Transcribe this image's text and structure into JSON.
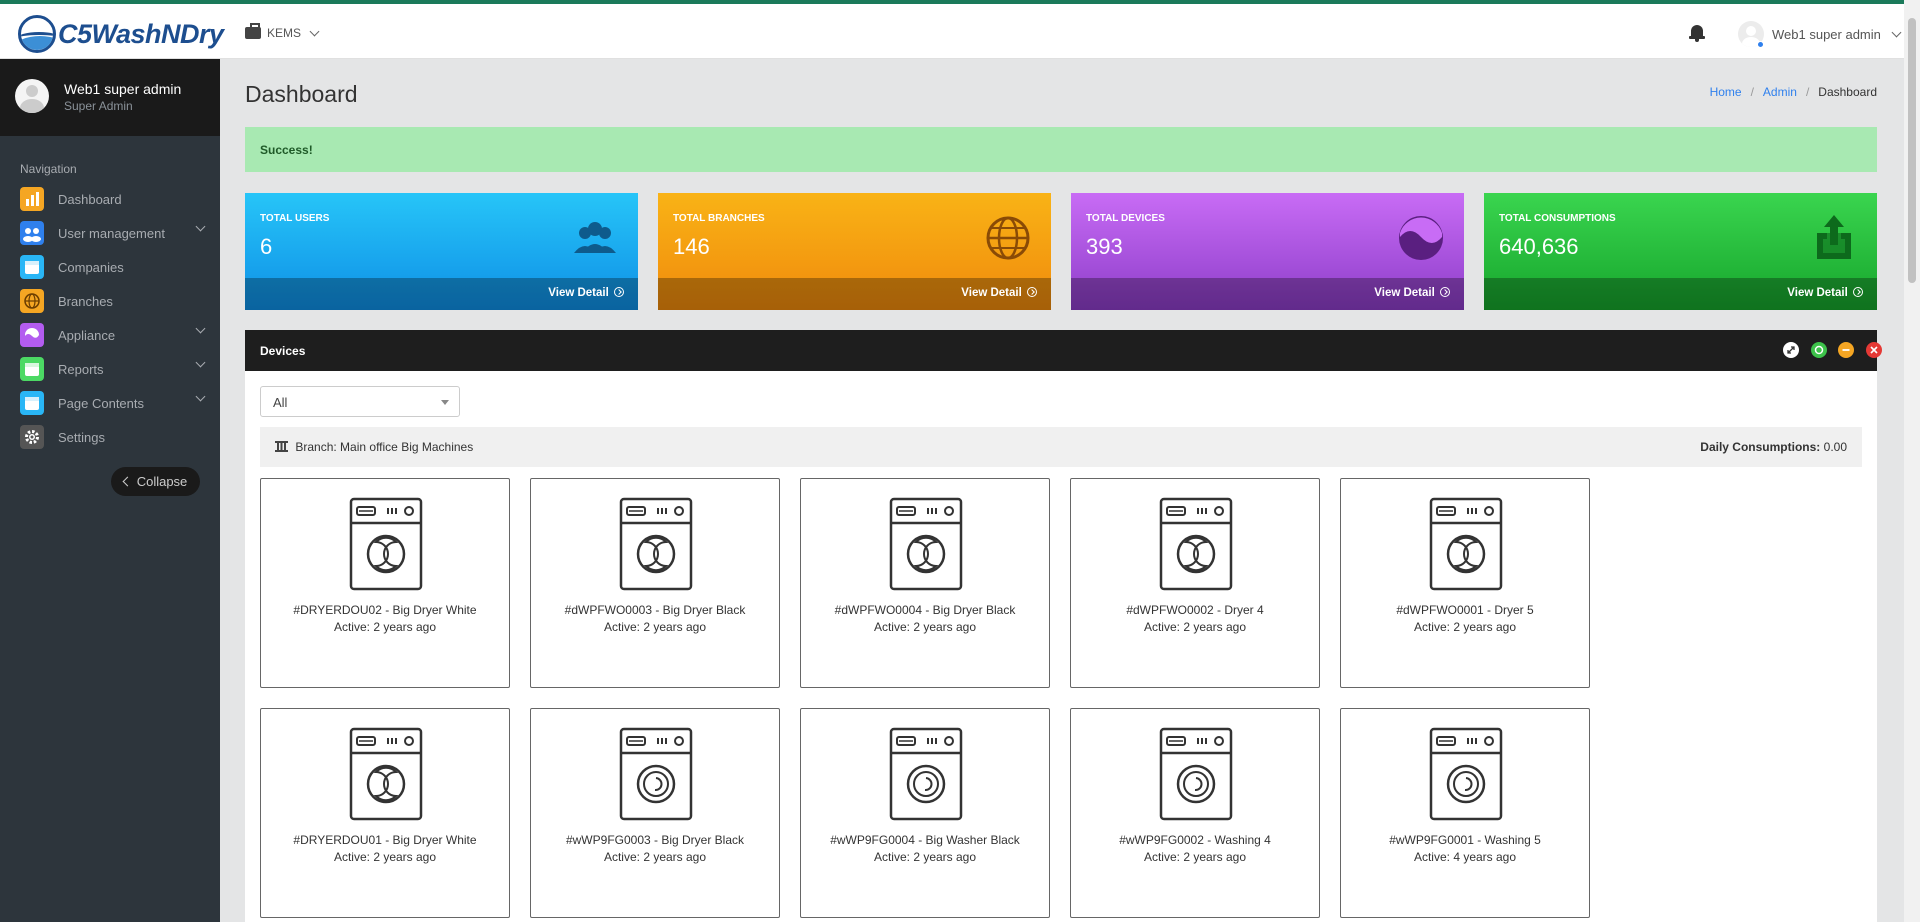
{
  "header": {
    "logo_text": "C5WashNDry",
    "company": "KEMS",
    "user_name": "Web1 super admin"
  },
  "sidebar": {
    "profile_name": "Web1 super admin",
    "profile_role": "Super Admin",
    "nav_title": "Navigation",
    "items": [
      {
        "label": "Dashboard",
        "icon": "bar-chart-icon",
        "color": "#f5a623"
      },
      {
        "label": "User management",
        "icon": "users-icon",
        "color": "#2f80ed"
      },
      {
        "label": "Companies",
        "icon": "calendar-icon",
        "color": "#29b6f6"
      },
      {
        "label": "Branches",
        "icon": "globe-icon",
        "color": "#f5a623"
      },
      {
        "label": "Appliance",
        "icon": "wave-icon",
        "color": "#b35cf0"
      },
      {
        "label": "Reports",
        "icon": "calendar-icon",
        "color": "#4cd964"
      },
      {
        "label": "Page Contents",
        "icon": "calendar-icon",
        "color": "#29b6f6"
      },
      {
        "label": "Settings",
        "icon": "gear-icon",
        "color": "#555555"
      }
    ],
    "collapse_label": "Collapse"
  },
  "page": {
    "title": "Dashboard",
    "breadcrumb": [
      "Home",
      "Admin",
      "Dashboard"
    ],
    "alert": "Success!"
  },
  "stats": [
    {
      "label": "TOTAL USERS",
      "value": "6",
      "link": "View Detail",
      "color": "#1ea4f0",
      "icon": "users-icon"
    },
    {
      "label": "TOTAL BRANCHES",
      "value": "146",
      "link": "View Detail",
      "color": "#f5a20e",
      "icon": "globe-icon"
    },
    {
      "label": "TOTAL DEVICES",
      "value": "393",
      "link": "View Detail",
      "color": "#a04de0",
      "icon": "wave-icon"
    },
    {
      "label": "TOTAL CONSUMPTIONS",
      "value": "640,636",
      "link": "View Detail",
      "color": "#22c33b",
      "icon": "share-icon"
    }
  ],
  "devices_panel": {
    "title": "Devices",
    "filter_value": "All",
    "branch_label": "Branch:",
    "branch_name": "Main office Big Machines",
    "daily_label": "Daily Consumptions:",
    "daily_value": "0.00",
    "devices": [
      {
        "name": "#DRYERDOU02 - Big Dryer White",
        "active": "Active: 2 years ago"
      },
      {
        "name": "#dWPFWO0003 - Big Dryer Black",
        "active": "Active: 2 years ago"
      },
      {
        "name": "#dWPFWO0004 - Big Dryer Black",
        "active": "Active: 2 years ago"
      },
      {
        "name": "#dWPFWO0002 - Dryer 4",
        "active": "Active: 2 years ago"
      },
      {
        "name": "#dWPFWO0001 - Dryer 5",
        "active": "Active: 2 years ago"
      },
      {
        "name": "#DRYERDOU01 - Big Dryer White",
        "active": "Active: 2 years ago"
      },
      {
        "name": "#wWP9FG0003 - Big Dryer Black",
        "active": "Active: 2 years ago"
      },
      {
        "name": "#wWP9FG0004 - Big Washer Black",
        "active": "Active: 2 years ago"
      },
      {
        "name": "#wWP9FG0002 - Washing 4",
        "active": "Active: 2 years ago"
      },
      {
        "name": "#wWP9FG0001 - Washing 5",
        "active": "Active: 4 years ago"
      }
    ]
  }
}
